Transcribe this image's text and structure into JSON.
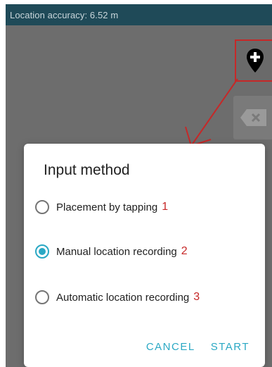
{
  "statusbar": {
    "text": "Location accuracy: 6.52 m"
  },
  "toolbar": {
    "add_location_icon": "map-marker-plus",
    "delete_icon": "backspace"
  },
  "dialog": {
    "title": "Input method",
    "options": [
      {
        "label": "Placement by tapping",
        "annotation": "1",
        "selected": false
      },
      {
        "label": "Manual location recording",
        "annotation": "2",
        "selected": true
      },
      {
        "label": "Automatic location recording",
        "annotation": "3",
        "selected": false
      }
    ],
    "cancel_label": "CANCEL",
    "start_label": "START"
  },
  "colors": {
    "accent": "#2aa8c4",
    "annotation": "#c62828",
    "statusbar": "#1f4a58"
  }
}
